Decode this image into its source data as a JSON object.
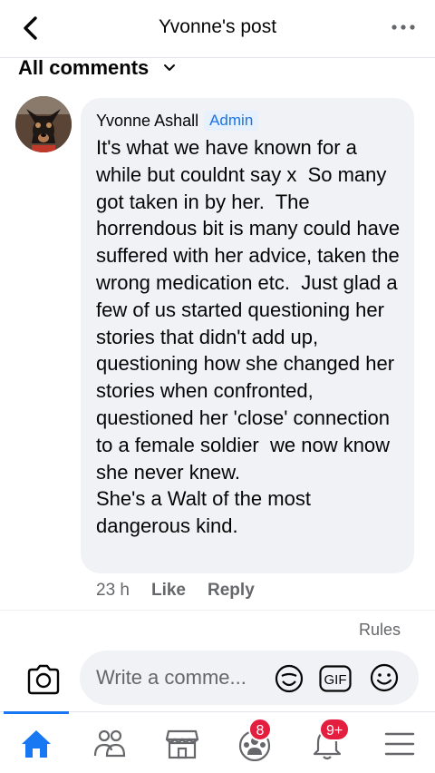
{
  "header": {
    "title": "Yvonne's post",
    "back_icon": "chevron-left-icon",
    "more_icon": "more-horizontal-icon"
  },
  "filter": {
    "label": "All comments",
    "icon": "chevron-down-icon"
  },
  "comment": {
    "author": "Yvonne Ashall",
    "badge": "Admin",
    "text": "It's what we have known for a while but couldnt say x  So many got taken in by her.  The horrendous bit is many could have suffered with her advice, taken the wrong medication etc.  Just glad a few of us started questioning her stories that didn't add up, questioning how she changed her stories when confronted, questioned her 'close' connection to a female soldier  we now know she never knew.\nShe's a Walt of the most dangerous kind.",
    "time": "23 h",
    "like_label": "Like",
    "reply_label": "Reply"
  },
  "rules_label": "Rules",
  "composer": {
    "placeholder": "Write a comme...",
    "gif_label": "GIF"
  },
  "tabbar": {
    "tabs": [
      {
        "name": "home",
        "icon": "home-icon",
        "badge": ""
      },
      {
        "name": "friends",
        "icon": "friends-icon",
        "badge": ""
      },
      {
        "name": "marketplace",
        "icon": "marketplace-icon",
        "badge": ""
      },
      {
        "name": "groups",
        "icon": "groups-icon",
        "badge": "8"
      },
      {
        "name": "notifications",
        "icon": "bell-icon",
        "badge": "9+"
      },
      {
        "name": "menu",
        "icon": "menu-icon",
        "badge": ""
      }
    ]
  },
  "colors": {
    "accent": "#1877f2",
    "badge_red": "#e41e3f",
    "bubble": "#f0f2f5",
    "secondary_text": "#65676b"
  }
}
